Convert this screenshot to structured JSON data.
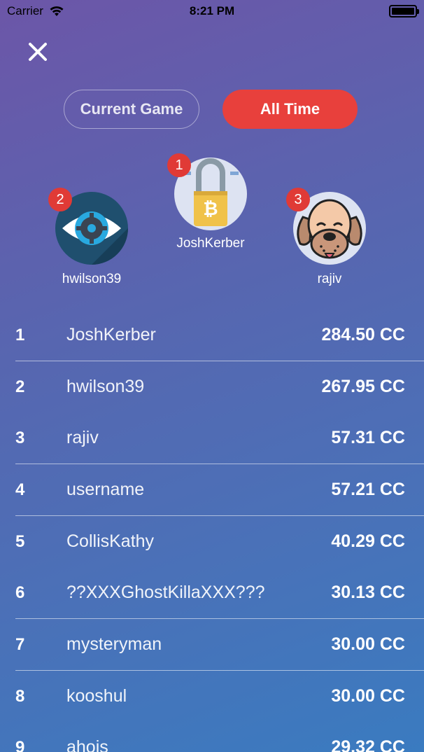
{
  "status": {
    "carrier": "Carrier",
    "time": "8:21 PM"
  },
  "tabs": {
    "current": "Current Game",
    "all_time": "All Time",
    "selected": "All Time"
  },
  "podium": [
    {
      "rank": "1",
      "name": "JoshKerber",
      "avatar": "bitcoin-padlock-icon"
    },
    {
      "rank": "2",
      "name": "hwilson39",
      "avatar": "eye-gear-icon"
    },
    {
      "rank": "3",
      "name": "rajiv",
      "avatar": "dog-face-icon"
    }
  ],
  "leaderboard": [
    {
      "rank": "1",
      "name": "JoshKerber",
      "score": "284.50 CC"
    },
    {
      "rank": "2",
      "name": "hwilson39",
      "score": "267.95 CC"
    },
    {
      "rank": "3",
      "name": "rajiv",
      "score": "57.31 CC"
    },
    {
      "rank": "4",
      "name": "username",
      "score": "57.21 CC"
    },
    {
      "rank": "5",
      "name": "CollisKathy",
      "score": "40.29 CC"
    },
    {
      "rank": "6",
      "name": "??XXXGhostKillaXXX???",
      "score": "30.13 CC"
    },
    {
      "rank": "7",
      "name": "mysteryman",
      "score": "30.00 CC"
    },
    {
      "rank": "8",
      "name": "kooshul",
      "score": "30.00 CC"
    },
    {
      "rank": "9",
      "name": "ahois",
      "score": "29.32 CC"
    }
  ],
  "colors": {
    "accent": "#e8403c",
    "badge": "#e03a36"
  }
}
